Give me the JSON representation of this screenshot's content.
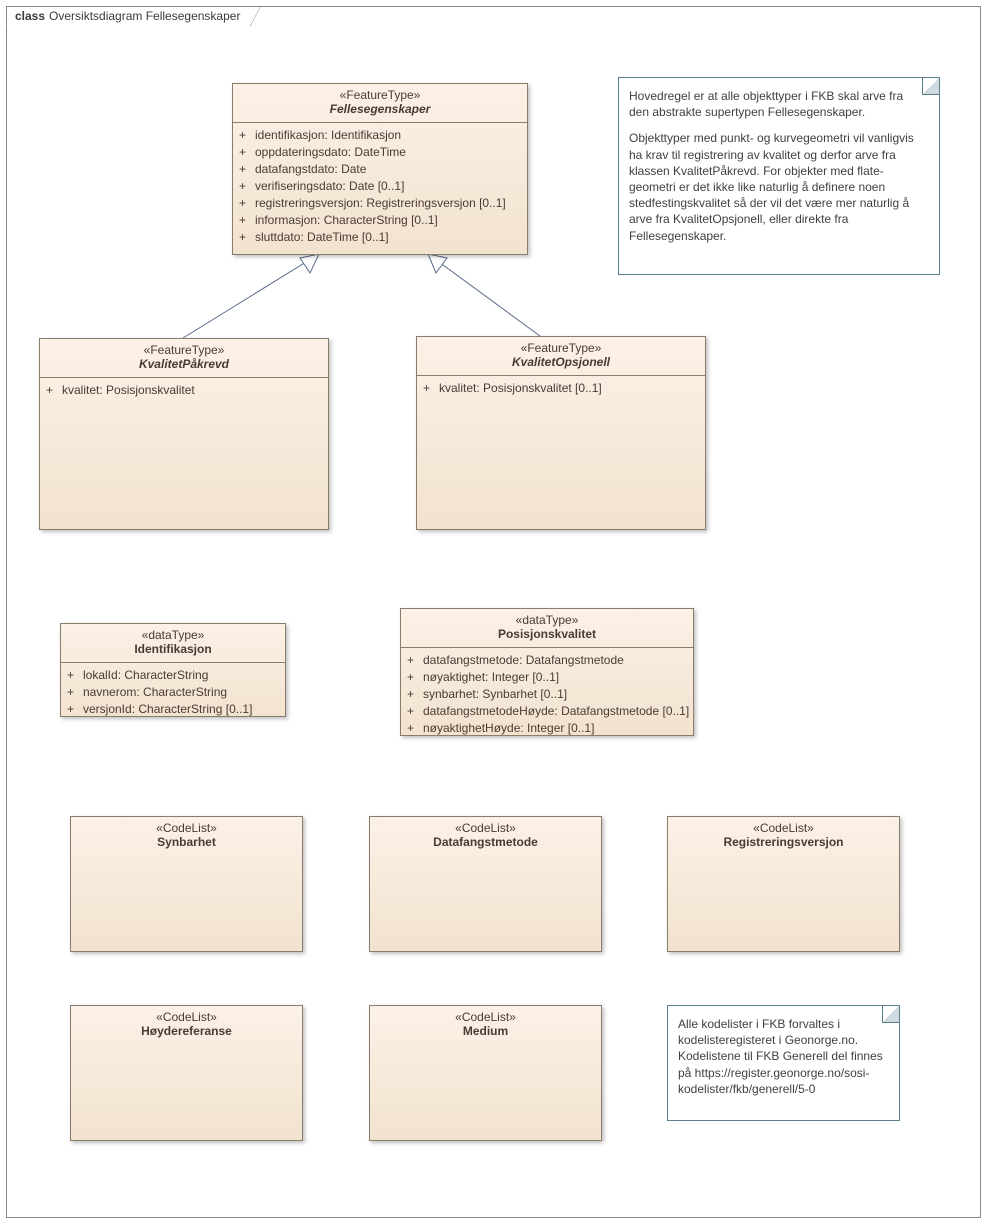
{
  "frame": {
    "keyword": "class",
    "title": "Oversiktsdiagram Fellesegenskaper"
  },
  "classes": {
    "fellesegenskaper": {
      "stereotype": "«FeatureType»",
      "name": "Fellesegenskaper",
      "abstract": true,
      "attrs": {
        "a0": "identifikasjon: Identifikasjon",
        "a1": "oppdateringsdato: DateTime",
        "a2": "datafangstdato: Date",
        "a3": "verifiseringsdato: Date [0..1]",
        "a4": "registreringsversjon: Registreringsversjon [0..1]",
        "a5": "informasjon: CharacterString [0..1]",
        "a6": "sluttdato: DateTime [0..1]"
      }
    },
    "kvalitetPakrevd": {
      "stereotype": "«FeatureType»",
      "name": "KvalitetPåkrevd",
      "abstract": true,
      "attrs": {
        "a0": "kvalitet: Posisjonskvalitet"
      }
    },
    "kvalitetOpsjonell": {
      "stereotype": "«FeatureType»",
      "name": "KvalitetOpsjonell",
      "abstract": true,
      "attrs": {
        "a0": "kvalitet: Posisjonskvalitet [0..1]"
      }
    },
    "identifikasjon": {
      "stereotype": "«dataType»",
      "name": "Identifikasjon",
      "attrs": {
        "a0": "lokalId: CharacterString",
        "a1": "navnerom: CharacterString",
        "a2": "versjonId: CharacterString [0..1]"
      }
    },
    "posisjonskvalitet": {
      "stereotype": "«dataType»",
      "name": "Posisjonskvalitet",
      "attrs": {
        "a0": "datafangstmetode: Datafangstmetode",
        "a1": "nøyaktighet: Integer [0..1]",
        "a2": "synbarhet: Synbarhet [0..1]",
        "a3": "datafangstmetodeHøyde: Datafangstmetode [0..1]",
        "a4": "nøyaktighetHøyde: Integer [0..1]"
      }
    },
    "synbarhet": {
      "stereotype": "«CodeList»",
      "name": "Synbarhet"
    },
    "datafangstmetode": {
      "stereotype": "«CodeList»",
      "name": "Datafangstmetode"
    },
    "registreringsversjon": {
      "stereotype": "«CodeList»",
      "name": "Registreringsversjon"
    },
    "hoydereferanse": {
      "stereotype": "«CodeList»",
      "name": "Høydereferanse"
    },
    "medium": {
      "stereotype": "«CodeList»",
      "name": "Medium"
    }
  },
  "notes": {
    "top": {
      "p1": "Hovedregel er at alle objekttyper i FKB skal arve fra den abstrakte supertypen Fellesegenskaper.",
      "p2": "Objekttyper med punkt- og kurvegeometri vil vanligvis ha krav til registrering av kvalitet og derfor arve fra klassen KvalitetPåkrevd. For objekter med flate-geometri er det ikke like naturlig å definere noen stedfestingskvalitet så der vil det være mer naturlig å arve fra KvalitetOpsjonell, eller direkte fra Fellesegenskaper."
    },
    "bottom": {
      "p1": "Alle kodelister i FKB forvaltes i kodelisteregisteret i Geonorge.no. Kodelistene til FKB Generell del finnes på https://register.geonorge.no/sosi-kodelister/fkb/generell/5-0"
    }
  },
  "vis": "+"
}
